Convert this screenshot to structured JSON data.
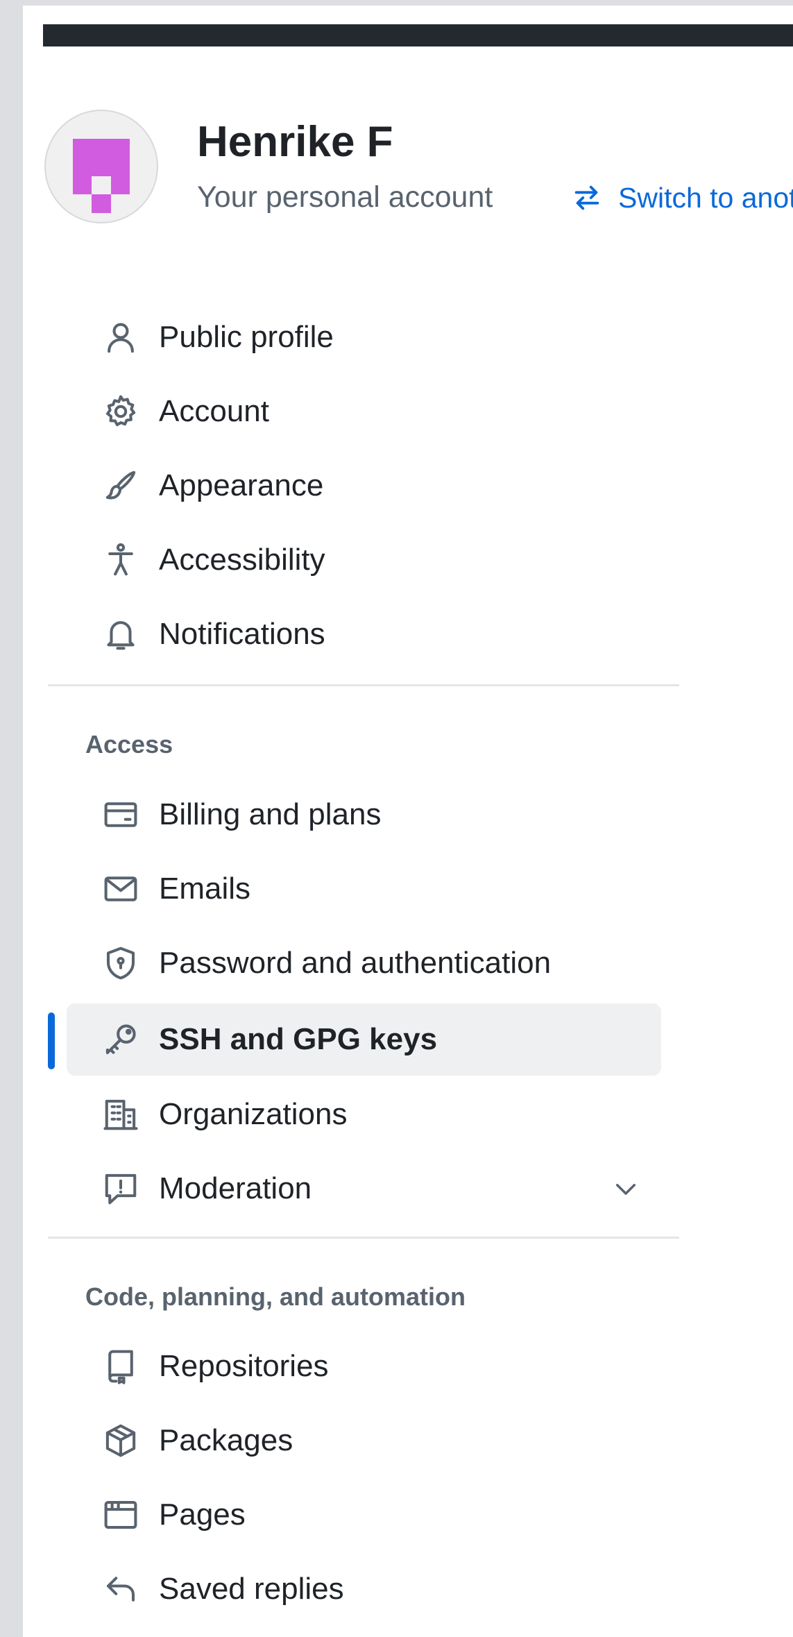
{
  "account": {
    "name": "Henrike F",
    "subtitle": "Your personal account",
    "switch_label": "Switch to another account"
  },
  "colors": {
    "accent": "#0969da",
    "avatar": "#d25ce0",
    "selected_bg": "#eff0f2",
    "muted_text": "#59636e"
  },
  "nav": {
    "general": [
      {
        "label": "Public profile",
        "icon": "person-icon"
      },
      {
        "label": "Account",
        "icon": "gear-icon"
      },
      {
        "label": "Appearance",
        "icon": "paintbrush-icon"
      },
      {
        "label": "Accessibility",
        "icon": "accessibility-icon"
      },
      {
        "label": "Notifications",
        "icon": "bell-icon"
      }
    ],
    "access_header": "Access",
    "access": [
      {
        "label": "Billing and plans",
        "icon": "credit-card-icon"
      },
      {
        "label": "Emails",
        "icon": "mail-icon"
      },
      {
        "label": "Password and authentication",
        "icon": "shield-lock-icon"
      },
      {
        "label": "SSH and GPG keys",
        "icon": "key-icon",
        "selected": true
      },
      {
        "label": "Organizations",
        "icon": "organization-icon"
      },
      {
        "label": "Moderation",
        "icon": "report-icon",
        "expandable": true
      }
    ],
    "code_header": "Code, planning, and automation",
    "code": [
      {
        "label": "Repositories",
        "icon": "repo-icon"
      },
      {
        "label": "Packages",
        "icon": "package-icon"
      },
      {
        "label": "Pages",
        "icon": "browser-icon"
      },
      {
        "label": "Saved replies",
        "icon": "reply-icon"
      }
    ]
  }
}
